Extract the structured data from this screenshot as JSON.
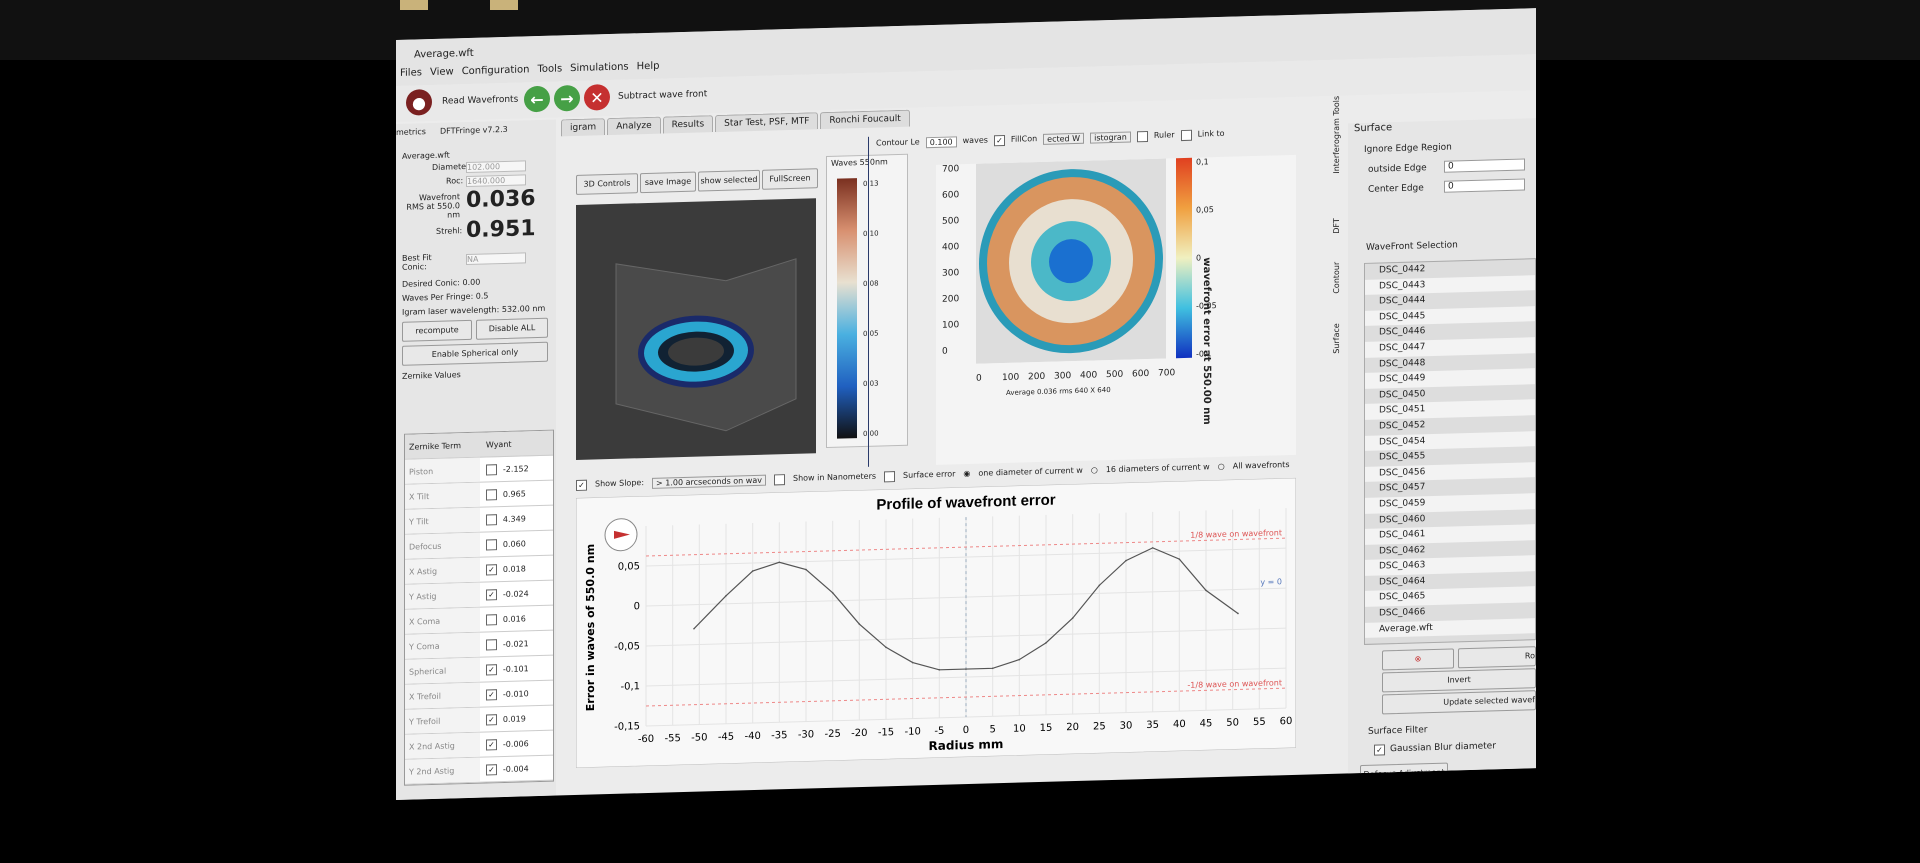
{
  "window": {
    "title": "Average.wft"
  },
  "menu": [
    "Files",
    "View",
    "Configuration",
    "Tools",
    "Simulations",
    "Help"
  ],
  "toolbar": {
    "read_label": "Read Wavefronts",
    "subtract_label": "Subtract wave front"
  },
  "app": {
    "left_label": "metrics",
    "version": "DFTFringe v7.2.3"
  },
  "tabs": [
    "igram",
    "Analyze",
    "Results",
    "Star Test, PSF, MTF",
    "Ronchi  Foucault"
  ],
  "left": {
    "file": "Average.wft",
    "diameter_label": "Diameter:",
    "diameter_value": "102.000",
    "roc_label": "Roc:",
    "roc_value": "1640.000",
    "rms_label": "Wavefront RMS at 550.0 nm",
    "rms_value": "0.036",
    "strehl_label": "Strehl:",
    "strehl_value": "0.951",
    "bestfit_label": "Best Fit Conic:",
    "bestfit_value": "NA",
    "desired_conic": "Desired Conic:  0.00",
    "waves_per_fringe": "Waves Per Fringe:  0.5",
    "igram_laser": "Igram laser wavelength:  532.00 nm",
    "recompute": "recompute",
    "disable_all": "Disable ALL",
    "enable_spherical": "Enable Spherical only",
    "zernike_title": "Zernike Values",
    "col_term": "Zernike Term",
    "col_wyant": "Wyant",
    "zernike": [
      {
        "name": "Piston",
        "checked": false,
        "value": "-2.152"
      },
      {
        "name": "X Tilt",
        "checked": false,
        "value": "0.965"
      },
      {
        "name": "Y Tilt",
        "checked": false,
        "value": "4.349"
      },
      {
        "name": "Defocus",
        "checked": false,
        "value": "0.060"
      },
      {
        "name": "X Astig",
        "checked": true,
        "value": "0.018"
      },
      {
        "name": "Y Astig",
        "checked": true,
        "value": "-0.024"
      },
      {
        "name": "X Coma",
        "checked": false,
        "value": "0.016"
      },
      {
        "name": "Y Coma",
        "checked": false,
        "value": "-0.021"
      },
      {
        "name": "Spherical",
        "checked": true,
        "value": "-0.101"
      },
      {
        "name": "X Trefoil",
        "checked": true,
        "value": "-0.010"
      },
      {
        "name": "Y Trefoil",
        "checked": true,
        "value": "0.019"
      },
      {
        "name": "X 2nd Astig",
        "checked": true,
        "value": "-0.006"
      },
      {
        "name": "Y 2nd Astig",
        "checked": true,
        "value": "-0.004"
      }
    ]
  },
  "mid": {
    "btn_3d": "3D Controls",
    "btn_save": "save Image",
    "btn_show": "show selected",
    "btn_full": "FullScreen",
    "cbar_title": "Waves 550nm",
    "cbar_ticks": [
      "0.13",
      "0.10",
      "0.08",
      "0.05",
      "0.03",
      "0.00"
    ],
    "contour_label": "Contour Le",
    "contour_value": "0.100",
    "waves_label": "waves",
    "fillcon": "FillCon",
    "ected": "ected W",
    "histogram": "istogran",
    "ruler": "Ruler",
    "link": "Link to",
    "ax_y": [
      "700",
      "600",
      "500",
      "400",
      "300",
      "200",
      "100",
      "0"
    ],
    "ax_x": [
      "0",
      "100",
      "200",
      "300",
      "400",
      "500",
      "600",
      "700"
    ],
    "cb2_ticks": [
      "0,1",
      "0,05",
      "0",
      "-0,05",
      "-0,1"
    ],
    "cb2_label": "wavefront error at 550.00 nm",
    "contour_caption": "Average  0.036 rms 640 X 640"
  },
  "profile_controls": {
    "show_slope": "Show Slope:",
    "slope_value": "> 1.00 arcseconds on wav",
    "show_nm": "Show in Nanometers",
    "surface_error": "Surface error",
    "one_diam": "one diameter of current w",
    "sixteen": "16 diameters of current w",
    "all": "All wavefronts"
  },
  "chart_data": {
    "type": "line",
    "title": "Profile of wavefront error",
    "xlabel": "Radius mm",
    "ylabel": "Error in waves of  550.0 nm",
    "xlim": [
      -60,
      60
    ],
    "ylim": [
      -0.15,
      0.1
    ],
    "xticks": [
      -60,
      -55,
      -50,
      -45,
      -40,
      -35,
      -30,
      -25,
      -20,
      -15,
      -10,
      -5,
      0,
      5,
      10,
      15,
      20,
      25,
      30,
      35,
      40,
      45,
      50,
      55,
      60
    ],
    "yticks": [
      {
        "v": 0.05,
        "t": "0,05"
      },
      {
        "v": 0,
        "t": "0"
      },
      {
        "v": -0.05,
        "t": "-0,05"
      },
      {
        "v": -0.1,
        "t": "-0,1"
      },
      {
        "v": -0.15,
        "t": "-0,15"
      }
    ],
    "annotations": [
      "1/8 wave on wavefront",
      "-1/8 wave on wavefront",
      "y = 0"
    ],
    "series": [
      {
        "x": [
          -51,
          -45,
          -40,
          -35,
          -30,
          -25,
          -20,
          -15,
          -10,
          -5,
          0,
          5,
          10,
          15,
          20,
          25,
          30,
          35,
          40,
          45,
          51
        ],
        "y": [
          -0.03,
          0.01,
          0.04,
          0.05,
          0.04,
          0.01,
          -0.03,
          -0.06,
          -0.08,
          -0.09,
          -0.09,
          -0.09,
          -0.08,
          -0.06,
          -0.03,
          0.01,
          0.04,
          0.055,
          0.04,
          0.0,
          -0.03
        ]
      }
    ]
  },
  "right": {
    "surface": "Surface",
    "ignore_edge": "Ignore Edge Region",
    "outside_label": "outside Edge",
    "outside_value": "0",
    "center_label": "Center Edge",
    "center_value": "0",
    "selection_title": "WaveFront Selection",
    "items": [
      "DSC_0442",
      "DSC_0443",
      "DSC_0444",
      "DSC_0445",
      "DSC_0446",
      "DSC_0447",
      "DSC_0448",
      "DSC_0449",
      "DSC_0450",
      "DSC_0451",
      "DSC_0452",
      "DSC_0454",
      "DSC_0455",
      "DSC_0456",
      "DSC_0457",
      "DSC_0459",
      "DSC_0460",
      "DSC_0461",
      "DSC_0462",
      "DSC_0463",
      "DSC_0464",
      "DSC_0465",
      "DSC_0466",
      "Average.wft"
    ],
    "rot": "Ro",
    "invert": "Invert",
    "update": "Update selected wavef",
    "filter_title": "Surface Filter",
    "gaussian": "Gaussian Blur diameter",
    "defocus_adj": "Defocus Adjustment"
  },
  "sidetabs": [
    "Surface",
    "Contour",
    "DFT",
    "Interferogram Tools"
  ],
  "colors": {
    "accent_red": "#c53030",
    "green": "#46a046",
    "curve": "#555555"
  }
}
